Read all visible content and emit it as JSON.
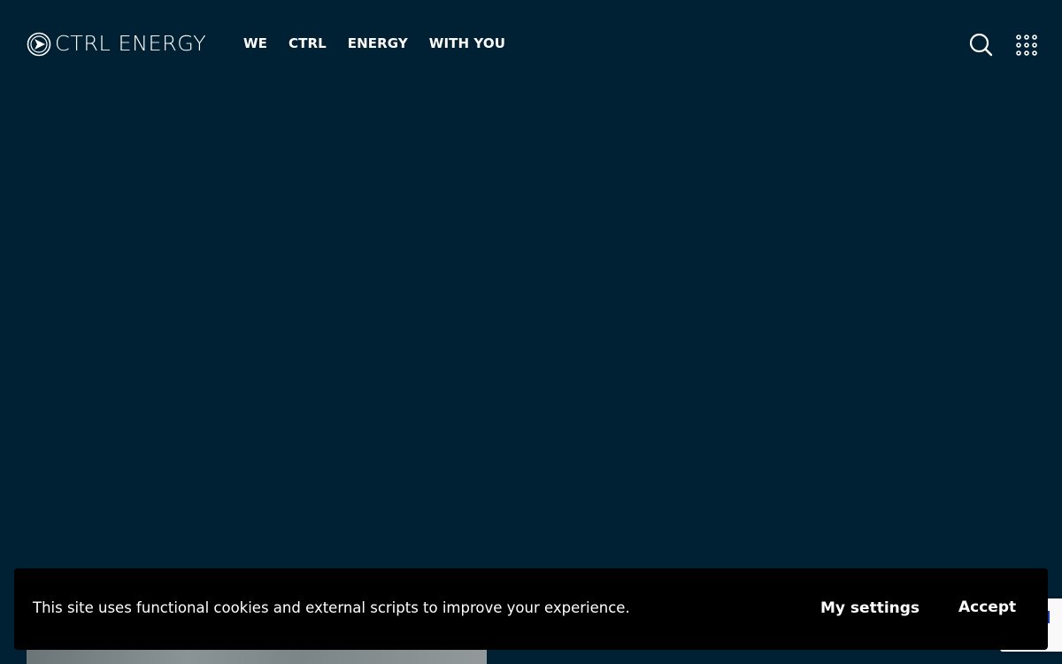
{
  "header": {
    "logo_text": "CTRL ENERGY",
    "nav": [
      {
        "label": "WE"
      },
      {
        "label": "CTRL"
      },
      {
        "label": "ENERGY"
      },
      {
        "label": "WITH YOU"
      }
    ],
    "search_icon": "search-icon",
    "menu_icon": "grid-menu-icon"
  },
  "cookie_banner": {
    "text": "This site uses functional cookies and external scripts to improve your experience.",
    "settings_label": "My settings",
    "accept_label": "Accept"
  },
  "colors": {
    "background": "#002033",
    "banner": "#000000",
    "text": "#ffffff"
  }
}
